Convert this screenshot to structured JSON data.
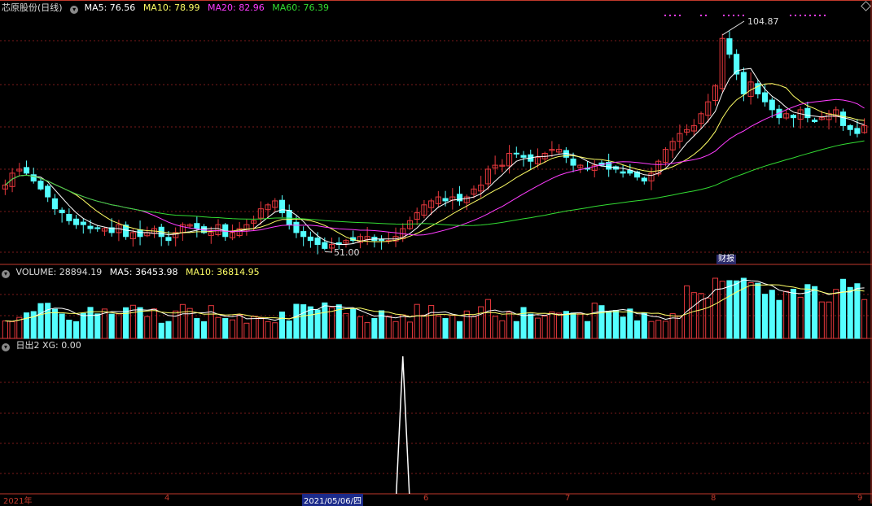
{
  "header": {
    "title": "芯原股份(日线)",
    "ma5": "MA5: 76.56",
    "ma10": "MA10: 78.99",
    "ma20": "MA20: 82.96",
    "ma60": "MA60: 76.39"
  },
  "volume_header": {
    "label": "VOLUME: 28894.19",
    "ma5": "MA5: 36453.98",
    "ma10": "MA10: 36814.95"
  },
  "indicator_header": {
    "label": "日出2 XG: 0.00"
  },
  "annotations": {
    "high": "104.87",
    "low": "51.00",
    "report": "财报"
  },
  "x_axis": {
    "labels": [
      "2021年",
      "4",
      "2021/05/06/四",
      "6",
      "7",
      "8",
      "9"
    ]
  },
  "colors": {
    "up": "#e8383d",
    "down": "#54ffff",
    "ma5": "#ffffff",
    "ma10": "#ffff66",
    "ma20": "#ff3cff",
    "ma60": "#33dd33",
    "grid": "#7a1a1a"
  },
  "chart_data": {
    "type": "candlestick",
    "ylim": [
      48,
      110
    ],
    "close": [
      67,
      70,
      71,
      70,
      68,
      66,
      64,
      61,
      60,
      58,
      57,
      57,
      56,
      56,
      56,
      55,
      57,
      54,
      55,
      54,
      55,
      56,
      54,
      53,
      55,
      57,
      57,
      56,
      55,
      55,
      57,
      54,
      55,
      56,
      57,
      58,
      61,
      62,
      63,
      60,
      57,
      55,
      54,
      53,
      52,
      51,
      52,
      52,
      53,
      53,
      54,
      54,
      53,
      53,
      53,
      54,
      56,
      58,
      60,
      62,
      63,
      64,
      63,
      64,
      63,
      64,
      66,
      67,
      71,
      72,
      72,
      75,
      75,
      74,
      73,
      74,
      75,
      76,
      76,
      74,
      72,
      72,
      71,
      72,
      72,
      71,
      71,
      70,
      70,
      69,
      68,
      70,
      73,
      76,
      78,
      80,
      81,
      82,
      85,
      88,
      92,
      104,
      100,
      95,
      90,
      93,
      90,
      88,
      86,
      84,
      85,
      84,
      86,
      84,
      83,
      84,
      85,
      86,
      82,
      81,
      80,
      82
    ],
    "ma_last": {
      "ma5": 76.56,
      "ma10": 78.99,
      "ma20": 82.96,
      "ma60": 76.39
    },
    "high_mark": 104.87,
    "low_mark": 51.0,
    "indicator": {
      "peak_index": 56,
      "value": 0.0
    }
  }
}
